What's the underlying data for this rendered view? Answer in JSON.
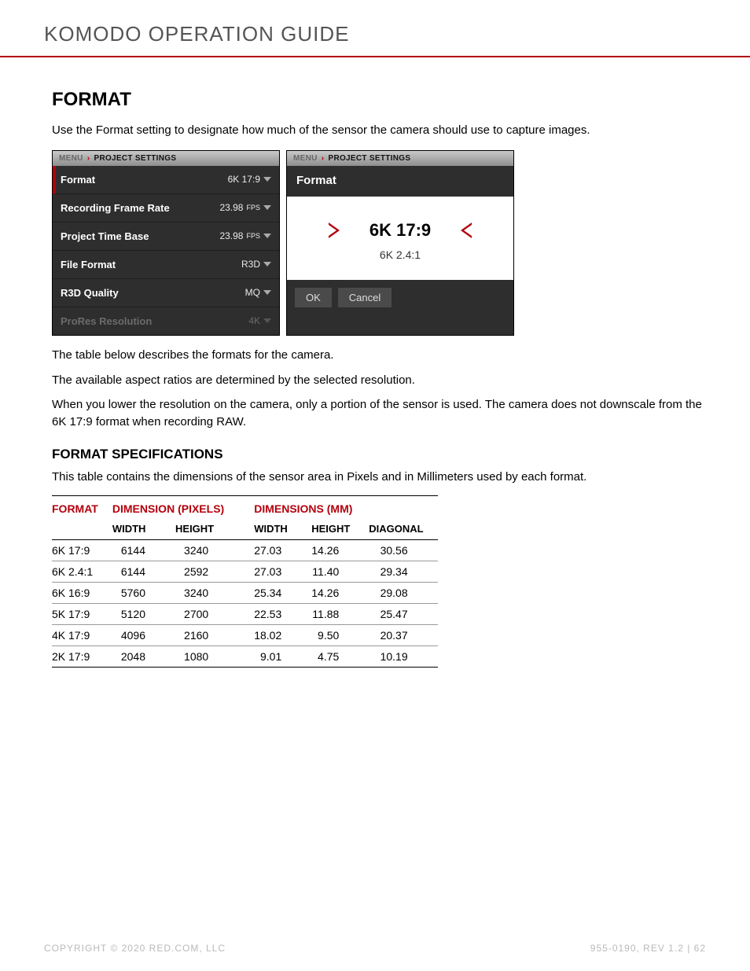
{
  "header": {
    "title": "KOMODO OPERATION GUIDE"
  },
  "section": {
    "title": "FORMAT",
    "intro": "Use the Format setting to designate how much of the sensor the camera should use to capture images.",
    "post": [
      "The table below describes the formats for the camera.",
      "The available aspect ratios are determined by the selected resolution.",
      "When you lower the resolution on the camera, only a portion of the sensor is used. The camera does not downscale from the 6K 17:9 format when recording RAW."
    ]
  },
  "panel1": {
    "breadcrumb": {
      "menu": "MENU",
      "crumb": "PROJECT SETTINGS"
    },
    "rows": [
      {
        "label": "Format",
        "value": "6K 17:9",
        "selected": true
      },
      {
        "label": "Recording Frame Rate",
        "value": "23.98",
        "suffix": "FPS"
      },
      {
        "label": "Project Time Base",
        "value": "23.98",
        "suffix": "FPS"
      },
      {
        "label": "File Format",
        "value": "R3D"
      },
      {
        "label": "R3D Quality",
        "value": "MQ"
      },
      {
        "label": "ProRes Resolution",
        "value": "4K",
        "disabled": true
      }
    ]
  },
  "panel2": {
    "breadcrumb": {
      "menu": "MENU",
      "crumb": "PROJECT SETTINGS"
    },
    "title": "Format",
    "selected": "6K 17:9",
    "next": "6K 2.4:1",
    "ok": "OK",
    "cancel": "Cancel"
  },
  "spec": {
    "title": "FORMAT SPECIFICATIONS",
    "desc": "This table contains the dimensions of the sensor area in Pixels and in Millimeters used by each format.",
    "headers": {
      "format": "FORMAT",
      "dim_px": "DIMENSION (PIXELS)",
      "dim_mm": "DIMENSIONS (MM)",
      "width": "WIDTH",
      "height": "HEIGHT",
      "diagonal": "DIAGONAL"
    },
    "rows": [
      {
        "format": "6K 17:9",
        "pw": "6144",
        "ph": "3240",
        "mw": "27.03",
        "mh": "14.26",
        "md": "30.56"
      },
      {
        "format": "6K 2.4:1",
        "pw": "6144",
        "ph": "2592",
        "mw": "27.03",
        "mh": "11.40",
        "md": "29.34"
      },
      {
        "format": "6K 16:9",
        "pw": "5760",
        "ph": "3240",
        "mw": "25.34",
        "mh": "14.26",
        "md": "29.08"
      },
      {
        "format": "5K 17:9",
        "pw": "5120",
        "ph": "2700",
        "mw": "22.53",
        "mh": "11.88",
        "md": "25.47"
      },
      {
        "format": "4K 17:9",
        "pw": "4096",
        "ph": "2160",
        "mw": "18.02",
        "mh": "9.50",
        "md": "20.37"
      },
      {
        "format": "2K 17:9",
        "pw": "2048",
        "ph": "1080",
        "mw": "9.01",
        "mh": "4.75",
        "md": "10.19"
      }
    ]
  },
  "footer": {
    "left": "COPYRIGHT © 2020 RED.COM, LLC",
    "right": "955-0190, REV 1.2  |  62"
  }
}
